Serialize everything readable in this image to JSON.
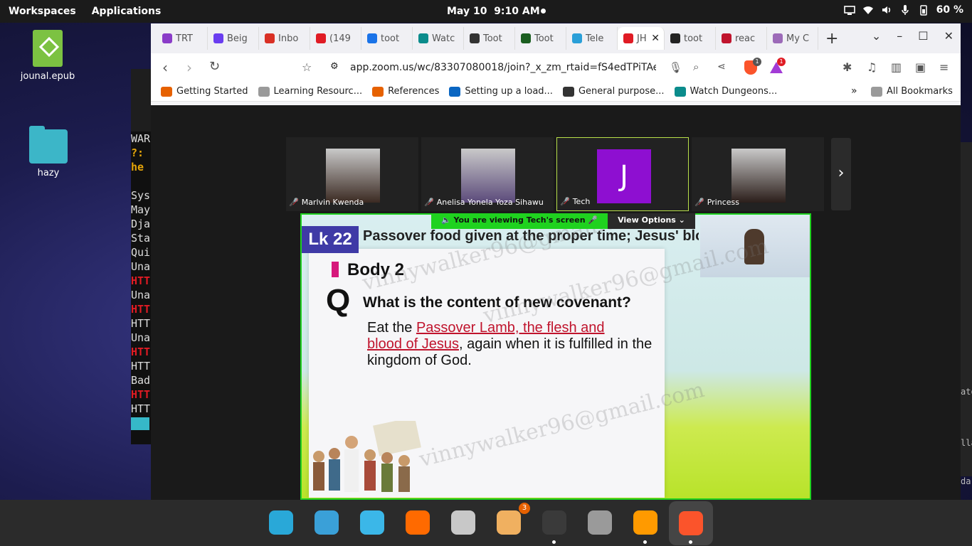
{
  "topbar": {
    "workspaces": "Workspaces",
    "applications": "Applications",
    "date": "May 10",
    "time": "9:10 AM",
    "battery": "60 %"
  },
  "desktop": {
    "icons": [
      {
        "label": "jounal.epub",
        "icon": "epub-file-icon"
      },
      {
        "label": "hazy",
        "icon": "folder-icon"
      }
    ]
  },
  "terminal": {
    "lines": [
      {
        "text": "WAR",
        "style": "normal"
      },
      {
        "text": "?:",
        "style": "yellow"
      },
      {
        "text": "he",
        "style": "yellow"
      },
      {
        "text": "",
        "style": "normal"
      },
      {
        "text": "Sys",
        "style": "normal"
      },
      {
        "text": "May",
        "style": "normal"
      },
      {
        "text": "Dja",
        "style": "normal"
      },
      {
        "text": "Sta",
        "style": "normal"
      },
      {
        "text": "Qui",
        "style": "normal"
      },
      {
        "text": "Una",
        "style": "normal"
      },
      {
        "text": "HTT",
        "style": "red"
      },
      {
        "text": "Una",
        "style": "normal"
      },
      {
        "text": "HTT",
        "style": "red"
      },
      {
        "text": "HTT",
        "style": "normal"
      },
      {
        "text": "Una",
        "style": "normal"
      },
      {
        "text": "HTT",
        "style": "red"
      },
      {
        "text": "HTT",
        "style": "normal"
      },
      {
        "text": "Bad",
        "style": "normal"
      },
      {
        "text": "HTT",
        "style": "red"
      },
      {
        "text": "HTT",
        "style": "normal"
      }
    ],
    "right_fragments": [
      "ato",
      "lla",
      "da"
    ]
  },
  "browser": {
    "tabs": [
      {
        "label": "TRT",
        "color": "#8a3cc8"
      },
      {
        "label": "Beig",
        "color": "#6a3df0"
      },
      {
        "label": "Inbo",
        "color": "#d93025"
      },
      {
        "label": "(149",
        "color": "#e01b24"
      },
      {
        "label": "toot",
        "color": "#1a73e8"
      },
      {
        "label": "Watc",
        "color": "#0b8c8c"
      },
      {
        "label": "Toot",
        "color": "#333333"
      },
      {
        "label": "Toot",
        "color": "#1b5e20"
      },
      {
        "label": "Tele",
        "color": "#2a9fd8"
      },
      {
        "label": "JH",
        "color": "#e01b24",
        "active": true
      },
      {
        "label": "toot",
        "color": "#222222"
      },
      {
        "label": "reac",
        "color": "#c0142d"
      },
      {
        "label": "My C",
        "color": "#9c6ab8"
      }
    ],
    "url": "app.zoom.us/wc/83307080018/join?_x_zm_rtaid=fS4edTPiTAeMiwq...",
    "brave_badge": "1",
    "rewards_badge": "1",
    "bookmarks": [
      {
        "label": "Getting Started",
        "color": "#e66100"
      },
      {
        "label": "Learning Resourc...",
        "color": "#9a9a9a"
      },
      {
        "label": "References",
        "color": "#e66100"
      },
      {
        "label": "Setting up a load...",
        "color": "#0a66c2"
      },
      {
        "label": "General purpose...",
        "color": "#333333"
      },
      {
        "label": "Watch Dungeons...",
        "color": "#0b8c8c"
      }
    ],
    "overflow": "»",
    "all_bookmarks": "All Bookmarks"
  },
  "zoom": {
    "participants": [
      {
        "name": "Marlvin Kwenda",
        "avatar": "photo",
        "color": "#3b2a22"
      },
      {
        "name": "Anelisa Yonela Yoza Sihawu",
        "avatar": "photo",
        "color": "#5b4a7a"
      },
      {
        "name": "Tech",
        "avatar": "J",
        "color": "#8e0fd1"
      },
      {
        "name": "Princess",
        "avatar": "photo",
        "color": "#2b1e1a"
      }
    ],
    "viewing_text": "You are viewing  Tech's screen",
    "view_options": "View Options",
    "slide": {
      "badge": "Lk 22",
      "title": "Passover food given at the proper time; Jesus' blood",
      "section": "Body 2",
      "q": "Q",
      "question": "What is the content of new covenant?",
      "answer_pre": "Eat the ",
      "answer_highlight_1": "Passover Lamb, the flesh and",
      "answer_highlight_2": "blood of Jesus",
      "answer_post": ", again when it is fulfilled in the kingdom of God."
    },
    "watermark": "vinnywalker96@gmail.com"
  },
  "dock": {
    "items": [
      {
        "name": "search-app",
        "color": "#29a8d8"
      },
      {
        "name": "window-manager",
        "color": "#3aa0d8"
      },
      {
        "name": "app-grid",
        "color": "#3bb7e8"
      },
      {
        "name": "firefox",
        "color": "#ff6a00"
      },
      {
        "name": "files",
        "color": "#c8c8c8"
      },
      {
        "name": "software-store",
        "color": "#f0b060"
      },
      {
        "name": "terminal",
        "color": "#3a3a3a"
      },
      {
        "name": "settings",
        "color": "#9a9a9a"
      },
      {
        "name": "sublime-text",
        "color": "#ff9a00"
      },
      {
        "name": "brave",
        "color": "#fb542b"
      }
    ],
    "store_badge": "3"
  }
}
